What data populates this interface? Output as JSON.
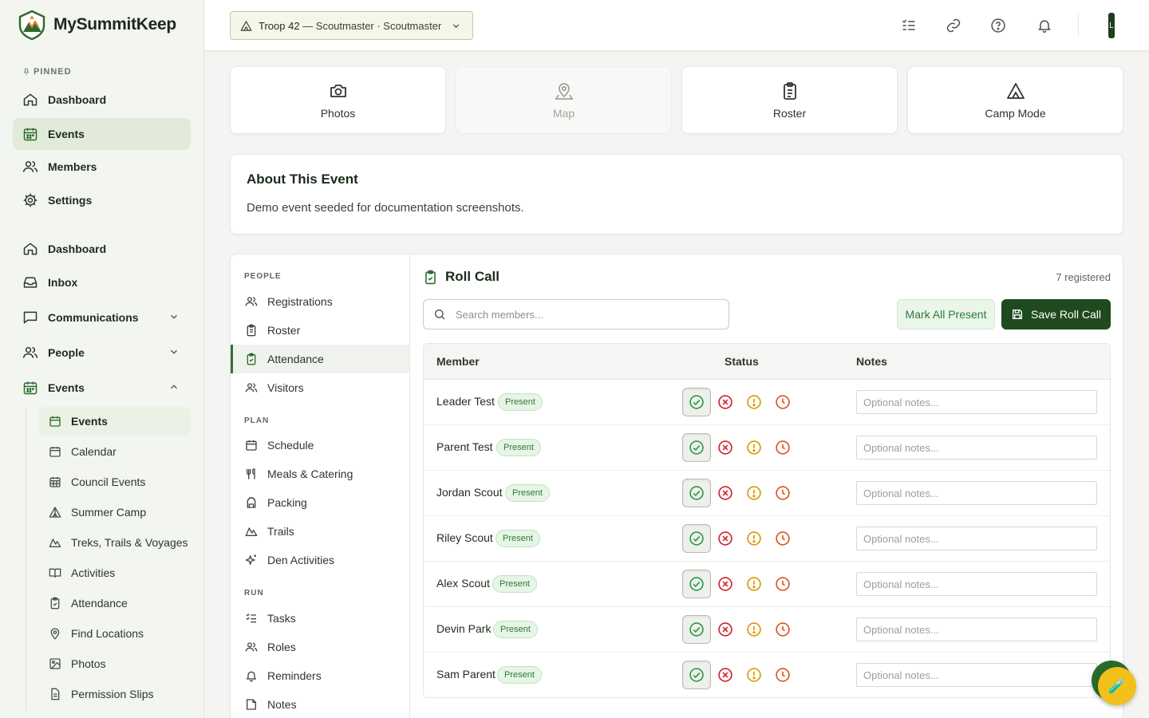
{
  "brand": {
    "name": "MySummitKeep"
  },
  "sidebar": {
    "pinned_label": "PINNED",
    "pinned": [
      {
        "label": "Dashboard",
        "icon": "home-icon"
      },
      {
        "label": "Events",
        "icon": "calendar-icon"
      },
      {
        "label": "Members",
        "icon": "users-icon"
      },
      {
        "label": "Settings",
        "icon": "gear-icon"
      }
    ],
    "main": [
      {
        "label": "Dashboard",
        "icon": "home-icon"
      },
      {
        "label": "Inbox",
        "icon": "inbox-icon"
      },
      {
        "label": "Communications",
        "icon": "message-icon",
        "expanded": false
      },
      {
        "label": "People",
        "icon": "users-icon",
        "expanded": false
      },
      {
        "label": "Events",
        "icon": "calendar-icon",
        "expanded": true
      }
    ],
    "events_sub": [
      {
        "label": "Events",
        "icon": "calendar-icon"
      },
      {
        "label": "Calendar",
        "icon": "calendar-icon"
      },
      {
        "label": "Council Events",
        "icon": "calendar-grid-icon"
      },
      {
        "label": "Summer Camp",
        "icon": "tent-icon"
      },
      {
        "label": "Treks, Trails & Voyages",
        "icon": "mountain-icon"
      },
      {
        "label": "Activities",
        "icon": "book-icon"
      },
      {
        "label": "Attendance",
        "icon": "clipboard-check-icon"
      },
      {
        "label": "Find Locations",
        "icon": "map-pin-icon"
      },
      {
        "label": "Photos",
        "icon": "image-icon"
      },
      {
        "label": "Permission Slips",
        "icon": "document-icon"
      }
    ]
  },
  "topbar": {
    "troop": "Troop 42",
    "role": " — Scoutmaster · Scoutmaster",
    "avatar_initial": "L"
  },
  "tiles": [
    {
      "label": "Photos",
      "icon": "camera-icon",
      "enabled": true
    },
    {
      "label": "Map",
      "icon": "map-pin-icon",
      "enabled": false
    },
    {
      "label": "Roster",
      "icon": "clipboard-icon",
      "enabled": true
    },
    {
      "label": "Camp Mode",
      "icon": "tent-icon",
      "enabled": true
    }
  ],
  "about": {
    "title": "About This Event",
    "description": "Demo event seeded for documentation screenshots."
  },
  "subnav": {
    "sections": [
      {
        "label": "PEOPLE",
        "items": [
          "Registrations",
          "Roster",
          "Attendance",
          "Visitors"
        ]
      },
      {
        "label": "PLAN",
        "items": [
          "Schedule",
          "Meals & Catering",
          "Packing",
          "Trails",
          "Den Activities"
        ]
      },
      {
        "label": "RUN",
        "items": [
          "Tasks",
          "Roles",
          "Reminders",
          "Notes"
        ]
      }
    ],
    "active": "Attendance"
  },
  "rollcall": {
    "title": "Roll Call",
    "count_text": "7 registered",
    "search_placeholder": "Search members...",
    "mark_all": "Mark All Present",
    "save": "Save Roll Call",
    "columns": {
      "member": "Member",
      "status": "Status",
      "notes": "Notes"
    },
    "notes_placeholder": "Optional notes...",
    "members": [
      {
        "name": "Leader Test",
        "status": "Present"
      },
      {
        "name": "Parent Test",
        "status": "Present"
      },
      {
        "name": "Jordan Scout",
        "status": "Present"
      },
      {
        "name": "Riley Scout",
        "status": "Present"
      },
      {
        "name": "Alex Scout",
        "status": "Present"
      },
      {
        "name": "Devin Park",
        "status": "Present"
      },
      {
        "name": "Sam Parent",
        "status": "Present"
      }
    ]
  },
  "colors": {
    "brand_green": "#1f4a1f",
    "present": "#2f9a4a",
    "absent": "#d2232a",
    "excused": "#d99a00",
    "late": "#e0531f",
    "fab": "#f2c01b"
  },
  "fab_icon": "🧪"
}
